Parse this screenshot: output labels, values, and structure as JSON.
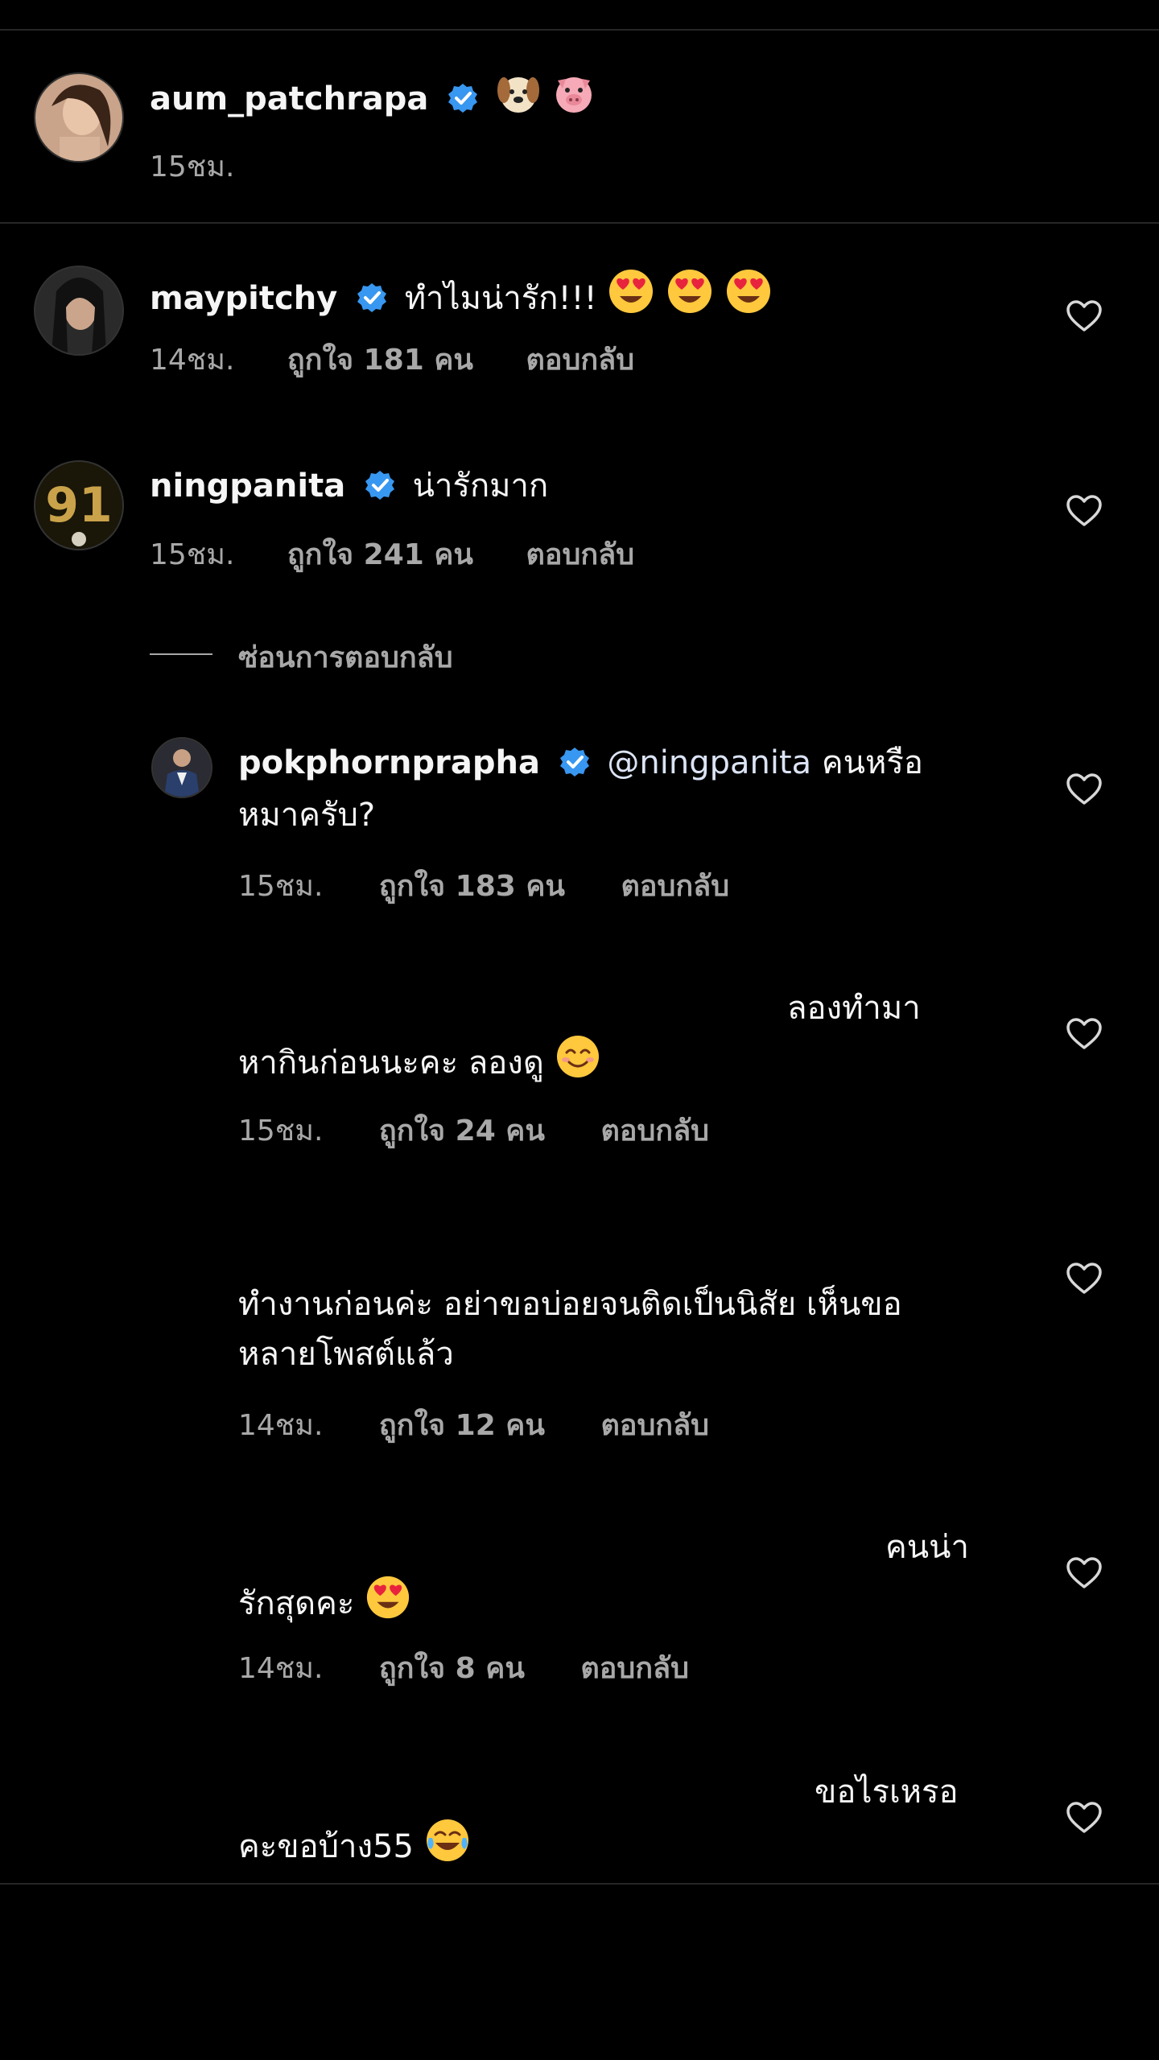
{
  "post": {
    "username": "aum_patchrapa",
    "caption_icons": [
      "dog-face-icon",
      "pig-face-icon"
    ],
    "time": "15ชม."
  },
  "comments": [
    {
      "username": "maypitchy",
      "text": "ทำไมน่ารัก!!!",
      "emojis": [
        "heart-eyes-icon",
        "heart-eyes-icon",
        "heart-eyes-icon"
      ],
      "time": "14ชม.",
      "likes": "ถูกใจ 181 คน",
      "reply": "ตอบกลับ"
    },
    {
      "username": "ningpanita",
      "text": "น่ารักมาก",
      "avatar_text": "91",
      "time": "15ชม.",
      "likes": "ถูกใจ 241 คน",
      "reply": "ตอบกลับ",
      "hide_replies": "ซ่อนการตอบกลับ"
    }
  ],
  "replies": [
    {
      "username": "pokphornprapha",
      "mention": "@ningpanita",
      "line1": " คนหรือ",
      "line2": "หมาครับ?",
      "time": "15ชม.",
      "likes": "ถูกใจ 183 คน",
      "reply": "ตอบกลับ"
    },
    {
      "line1": "ลองทำมา",
      "line2": "หากินก่อนนะคะ ลองดู",
      "emoji": "smiling-face-icon",
      "time": "15ชม.",
      "likes": "ถูกใจ 24 คน",
      "reply": "ตอบกลับ"
    },
    {
      "line1": "ทำงานก่อนค่ะ อย่าขอบ่อยจนติดเป็นนิสัย เห็นขอ",
      "line2": "หลายโพสต์แล้ว",
      "time": "14ชม.",
      "likes": "ถูกใจ 12 คน",
      "reply": "ตอบกลับ"
    },
    {
      "line1": "คนน่า",
      "line2": "รักสุดคะ",
      "emoji": "heart-eyes-icon",
      "time": "14ชม.",
      "likes": "ถูกใจ 8 คน",
      "reply": "ตอบกลับ"
    },
    {
      "line1": "ขอไรเหรอ",
      "line2": "คะขอบ้าง55",
      "emoji": "tears-of-joy-icon"
    }
  ],
  "colors": {
    "background": "#000000",
    "verified": "#3897f0",
    "muted": "#a8a8a8",
    "mention": "#dbe3f5"
  }
}
